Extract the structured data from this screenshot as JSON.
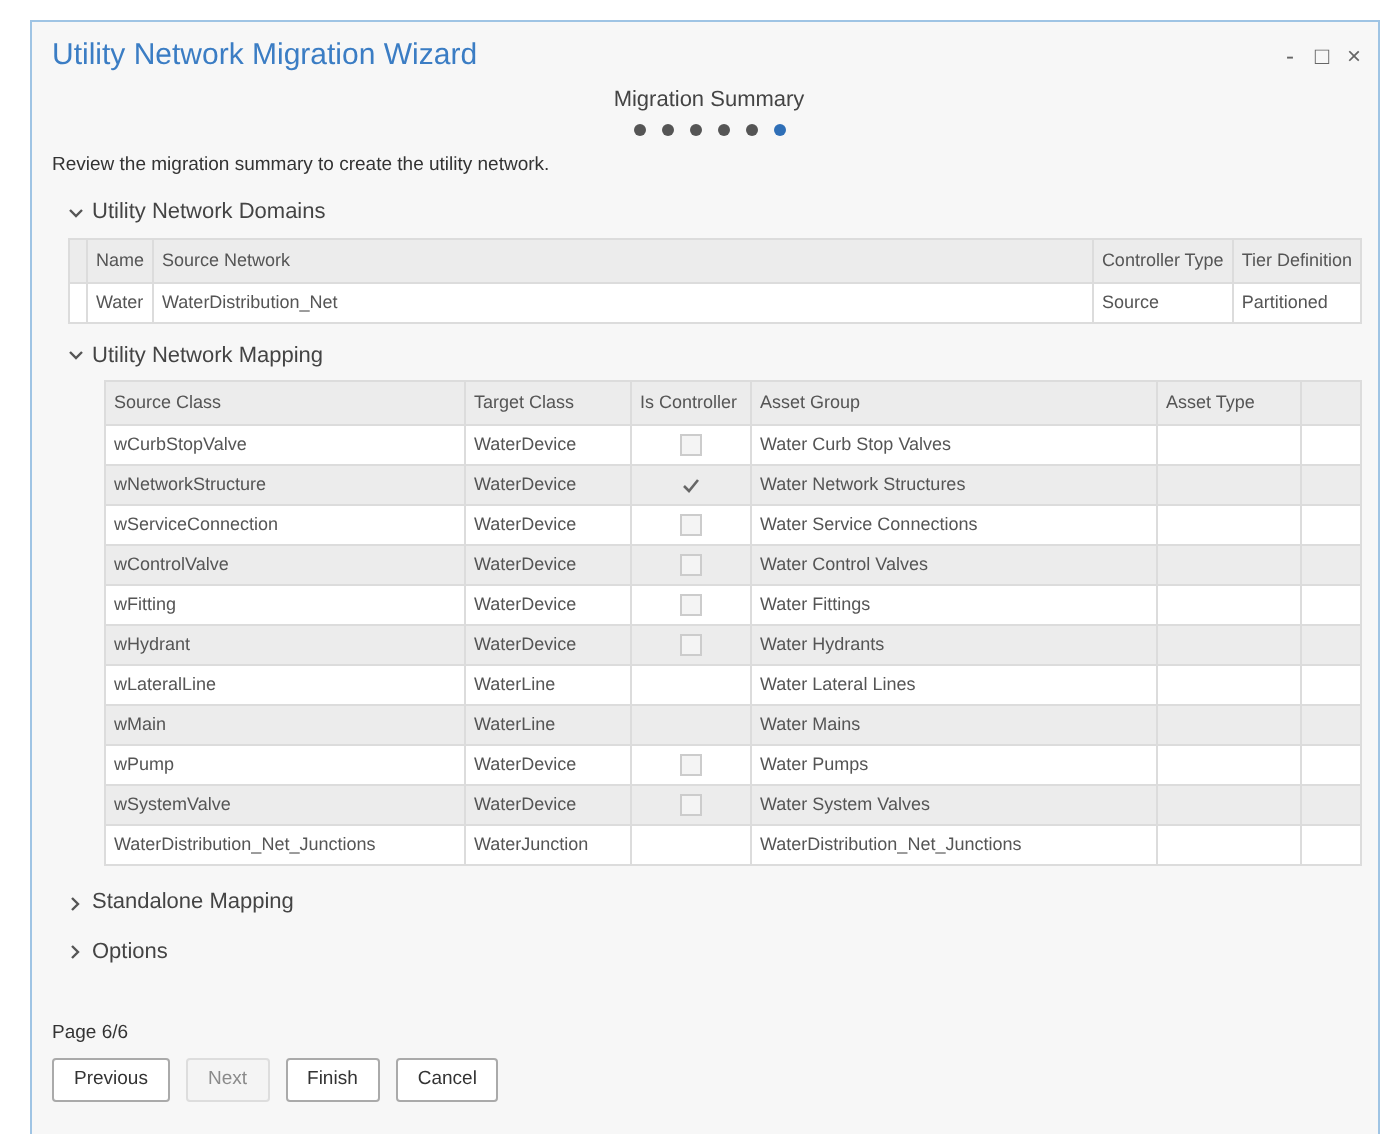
{
  "window": {
    "title": "Utility Network Migration Wizard",
    "controls": [
      "-",
      "□",
      "×"
    ]
  },
  "page_title": "Migration Summary",
  "steps": [
    {
      "selected": false
    },
    {
      "selected": false
    },
    {
      "selected": false
    },
    {
      "selected": false
    },
    {
      "selected": false
    },
    {
      "selected": true
    }
  ],
  "instruction": "Review the migration summary to create the utility network.",
  "domains": {
    "title": "Utility Network Domains",
    "expanded": true,
    "columns": [
      "Name",
      "Source Network",
      "Controller Type",
      "Tier Definition"
    ],
    "rows": [
      [
        "Water",
        "WaterDistribution_Net",
        "Source",
        "Partitioned"
      ]
    ]
  },
  "mapping": {
    "title": "Utility Network Mapping",
    "expanded": true,
    "columns": [
      "Source Class",
      "Target Class",
      "Is Controller",
      "Asset Group",
      "Asset Type"
    ],
    "rows": [
      {
        "source_class": "wCurbStopValve",
        "target_class": "WaterDevice",
        "has_checkbox": true,
        "checked": false,
        "asset_group": "Water Curb Stop Valves"
      },
      {
        "source_class": "wNetworkStructure",
        "target_class": "WaterDevice",
        "has_checkbox": true,
        "checked": true,
        "asset_group": "Water Network Structures"
      },
      {
        "source_class": "wServiceConnection",
        "target_class": "WaterDevice",
        "has_checkbox": true,
        "checked": false,
        "asset_group": "Water Service Connections"
      },
      {
        "source_class": "wControlValve",
        "target_class": "WaterDevice",
        "has_checkbox": true,
        "checked": false,
        "asset_group": "Water Control Valves"
      },
      {
        "source_class": "wFitting",
        "target_class": "WaterDevice",
        "has_checkbox": true,
        "checked": false,
        "asset_group": "Water Fittings"
      },
      {
        "source_class": "wHydrant",
        "target_class": "WaterDevice",
        "has_checkbox": true,
        "checked": false,
        "asset_group": "Water Hydrants"
      },
      {
        "source_class": "wLateralLine",
        "target_class": "WaterLine",
        "has_checkbox": false,
        "asset_group": "Water Lateral Lines"
      },
      {
        "source_class": "wMain",
        "target_class": "WaterLine",
        "has_checkbox": false,
        "asset_group": "Water Mains"
      },
      {
        "source_class": "wPump",
        "target_class": "WaterDevice",
        "has_checkbox": true,
        "checked": false,
        "asset_group": "Water Pumps"
      },
      {
        "source_class": "wSystemValve",
        "target_class": "WaterDevice",
        "has_checkbox": true,
        "checked": false,
        "asset_group": "Water System Valves"
      },
      {
        "source_class": "WaterDistribution_Net_Junctions",
        "target_class": "WaterJunction",
        "has_checkbox": false,
        "asset_group": "WaterDistribution_Net_Junctions"
      }
    ]
  },
  "collapsed_sections": [
    {
      "title": "Standalone Mapping",
      "expanded": false
    },
    {
      "title": "Options",
      "expanded": false
    }
  ],
  "page_indicator": "Page 6/6",
  "buttons": [
    {
      "label": "Previous",
      "disabled": false
    },
    {
      "label": "Next",
      "disabled": true
    },
    {
      "label": "Finish",
      "disabled": false
    },
    {
      "label": "Cancel",
      "disabled": false
    }
  ]
}
